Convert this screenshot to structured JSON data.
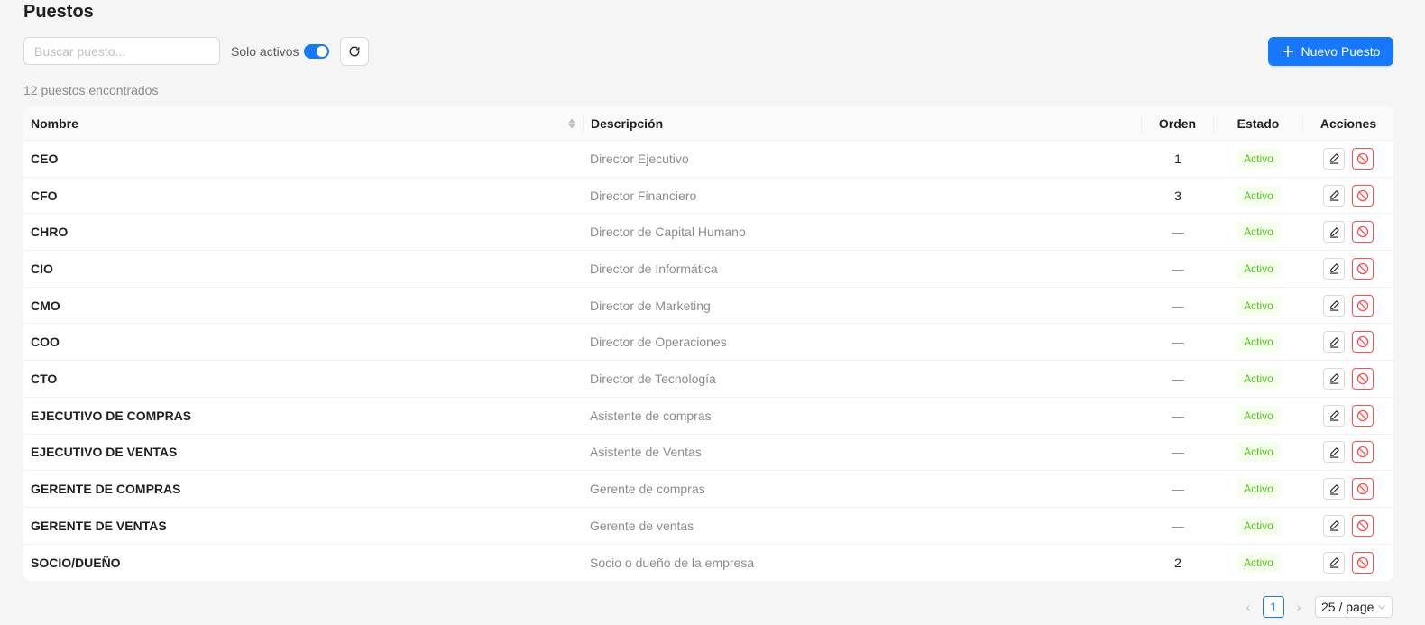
{
  "page": {
    "title": "Puestos",
    "search_placeholder": "Buscar puesto...",
    "toggle_label": "Solo activos",
    "toggle_on": true,
    "new_button_label": "Nuevo Puesto",
    "count_text": "12 puestos encontrados"
  },
  "table": {
    "headers": {
      "nombre": "Nombre",
      "descripcion": "Descripción",
      "orden": "Orden",
      "estado": "Estado",
      "acciones": "Acciones"
    },
    "rows": [
      {
        "nombre": "CEO",
        "descripcion": "Director Ejecutivo",
        "orden": "1",
        "estado": "Activo"
      },
      {
        "nombre": "CFO",
        "descripcion": "Director Financiero",
        "orden": "3",
        "estado": "Activo"
      },
      {
        "nombre": "CHRO",
        "descripcion": "Director de Capital Humano",
        "orden": "—",
        "estado": "Activo"
      },
      {
        "nombre": "CIO",
        "descripcion": "Director de Informática",
        "orden": "—",
        "estado": "Activo"
      },
      {
        "nombre": "CMO",
        "descripcion": "Director de Marketing",
        "orden": "—",
        "estado": "Activo"
      },
      {
        "nombre": "COO",
        "descripcion": "Director de Operaciones",
        "orden": "—",
        "estado": "Activo"
      },
      {
        "nombre": "CTO",
        "descripcion": "Director de Tecnología",
        "orden": "—",
        "estado": "Activo"
      },
      {
        "nombre": "EJECUTIVO DE COMPRAS",
        "descripcion": "Asistente de compras",
        "orden": "—",
        "estado": "Activo"
      },
      {
        "nombre": "EJECUTIVO DE VENTAS",
        "descripcion": "Asistente de Ventas",
        "orden": "—",
        "estado": "Activo"
      },
      {
        "nombre": "GERENTE DE COMPRAS",
        "descripcion": "Gerente de compras",
        "orden": "—",
        "estado": "Activo"
      },
      {
        "nombre": "GERENTE DE VENTAS",
        "descripcion": "Gerente de ventas",
        "orden": "—",
        "estado": "Activo"
      },
      {
        "nombre": "SOCIO/DUEÑO",
        "descripcion": "Socio o dueño de la empresa",
        "orden": "2",
        "estado": "Activo"
      }
    ]
  },
  "pagination": {
    "current_page": "1",
    "page_size": "25 / page",
    "prev_icon": "chevron-left-icon",
    "next_icon": "chevron-right-icon"
  },
  "colors": {
    "primary": "#1677ff",
    "success": "#52c41a",
    "danger": "#ff4d4f"
  }
}
